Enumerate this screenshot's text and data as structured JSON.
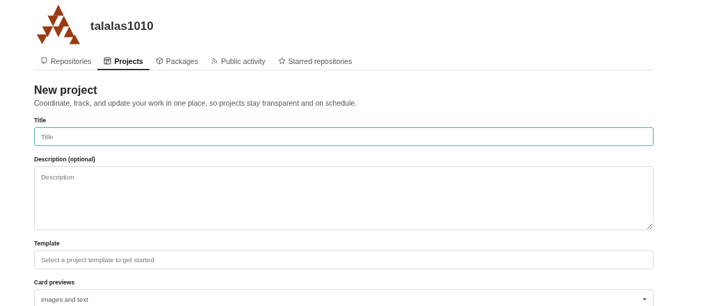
{
  "profile": {
    "username": "talalas1010"
  },
  "tabs": [
    {
      "label": "Repositories",
      "kind": "repo",
      "selected": false
    },
    {
      "label": "Projects",
      "kind": "project",
      "selected": true
    },
    {
      "label": "Packages",
      "kind": "package",
      "selected": false
    },
    {
      "label": "Public activity",
      "kind": "rss",
      "selected": false
    },
    {
      "label": "Starred repositories",
      "kind": "star",
      "selected": false
    }
  ],
  "heading": "New project",
  "subtitle": "Coordinate, track, and update your work in one place, so projects stay transparent and on schedule.",
  "fields": [
    {
      "kind": "input",
      "label": "Title",
      "placeholder": "Title",
      "focused": true
    },
    {
      "kind": "textarea",
      "label": "Description (optional)",
      "placeholder": "Description",
      "focused": false
    },
    {
      "kind": "input",
      "label": "Template",
      "placeholder": "Select a project template to get started",
      "focused": false
    },
    {
      "kind": "select",
      "label": "Card previews",
      "value": "Images and text",
      "focused": false
    }
  ]
}
